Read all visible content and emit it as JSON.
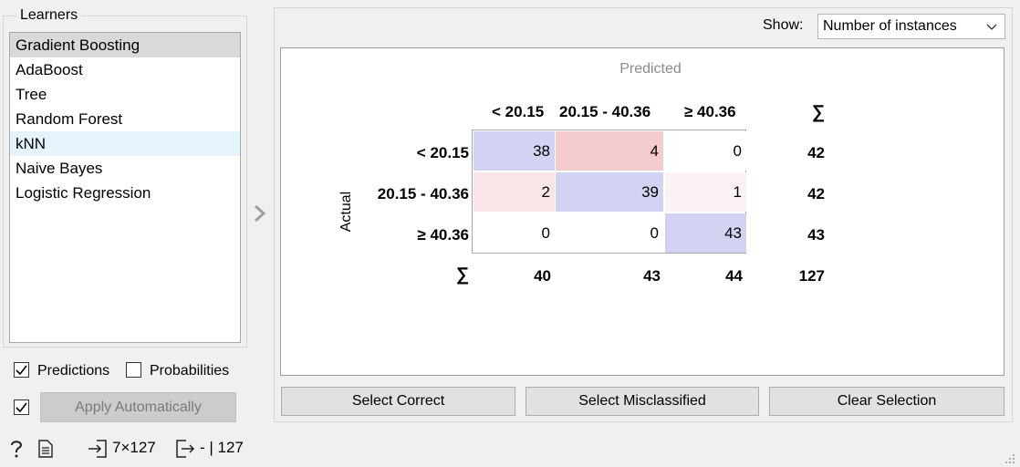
{
  "learners": {
    "title": "Learners",
    "items": [
      {
        "label": "Gradient Boosting",
        "state": "selected"
      },
      {
        "label": "AdaBoost",
        "state": ""
      },
      {
        "label": "Tree",
        "state": ""
      },
      {
        "label": "Random Forest",
        "state": ""
      },
      {
        "label": "kNN",
        "state": "hover"
      },
      {
        "label": "Naive Bayes",
        "state": ""
      },
      {
        "label": "Logistic Regression",
        "state": ""
      }
    ]
  },
  "options": {
    "predictions": {
      "label": "Predictions",
      "checked": true
    },
    "probabilities": {
      "label": "Probabilities",
      "checked": false
    },
    "apply_auto": {
      "label": "Apply Automatically",
      "checked": true
    }
  },
  "show": {
    "label": "Show:",
    "value": "Number of instances"
  },
  "matrix": {
    "predicted_title": "Predicted",
    "actual_title": "Actual",
    "sum_symbol": "∑",
    "classes": [
      "< 20.15",
      "20.15 - 40.36",
      "≥ 40.36"
    ],
    "cells": [
      [
        38,
        4,
        0
      ],
      [
        2,
        39,
        1
      ],
      [
        0,
        0,
        43
      ]
    ],
    "row_sums": [
      42,
      42,
      43
    ],
    "col_sums": [
      40,
      43,
      44
    ],
    "total": 127,
    "colors": {
      "correct": "#d2d2f3",
      "error_high": "#f4cbcf",
      "error_low": "#f9e5e7",
      "error_min": "#fcf2f3",
      "zero": "#ffffff"
    }
  },
  "buttons": {
    "select_correct": "Select Correct",
    "select_misclassified": "Select Misclassified",
    "clear_selection": "Clear Selection"
  },
  "status": {
    "input_summary": "7×127",
    "output_summary": "- | 127"
  }
}
